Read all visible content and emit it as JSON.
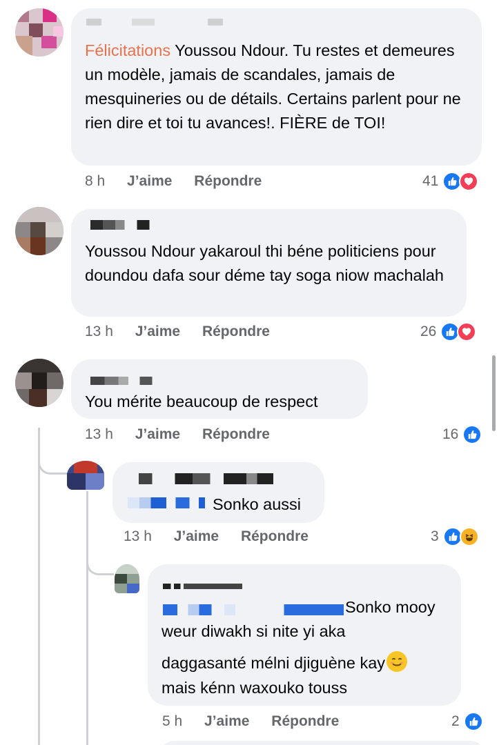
{
  "comments": [
    {
      "text_accent": "Félicitations",
      "text": " Youssou Ndour. Tu restes et demeures un modèle, jamais de scandales, jamais de mesquineries ou de détails. Certains parlent pour ne rien dire et toi tu avances!. FIÈRE de TOI!",
      "time": "8 h",
      "like_label": "J’aime",
      "reply_label": "Répondre",
      "reaction_count": "41",
      "reactions": [
        "like-icon",
        "love-icon"
      ]
    },
    {
      "text": "Youssou Ndour yakaroul thi béne politiciens pour doundou dafa sour déme tay soga niow machalah",
      "time": "13 h",
      "like_label": "J’aime",
      "reply_label": "Répondre",
      "reaction_count": "26",
      "reactions": [
        "like-icon",
        "love-icon"
      ]
    },
    {
      "text": "You mérite beaucoup de respect",
      "time": "13 h",
      "like_label": "J’aime",
      "reply_label": "Répondre",
      "reaction_count": "16",
      "reactions": [
        "like-icon"
      ]
    },
    {
      "text": "Sonko aussi",
      "time": "13 h",
      "like_label": "J’aime",
      "reply_label": "Répondre",
      "reaction_count": "3",
      "reactions": [
        "like-icon",
        "haha-icon"
      ]
    },
    {
      "text_line1": "Sonko mooy",
      "text_line2": "weur diwakh si nite yi aka",
      "text_line3": "daggasanté mélni djiguène kay",
      "text_line4": "mais kénn waxouko touss",
      "emoji": "smiling-face-emoji",
      "time": "5 h",
      "like_label": "J’aime",
      "reply_label": "Répondre",
      "reaction_count": "2",
      "reactions": [
        "like-icon"
      ]
    }
  ],
  "colors": {
    "bubble": "#f0f2f5",
    "meta_text": "#65676b",
    "accent_mention": "#e9724c",
    "like_blue": "#1877f2",
    "love_red": "#f33e58",
    "haha_yellow": "#f7b125"
  }
}
